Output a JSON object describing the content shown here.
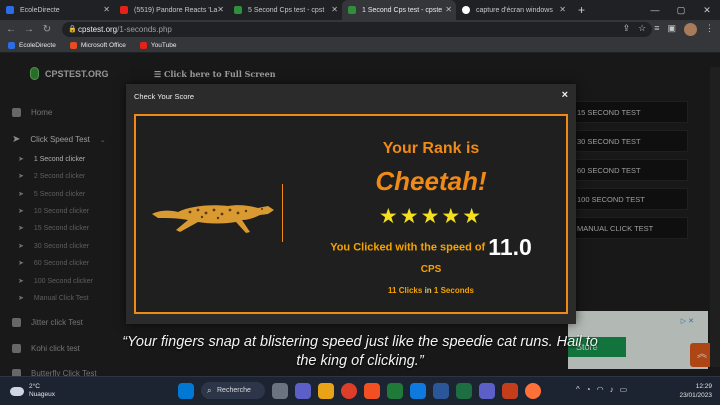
{
  "tabs": [
    {
      "label": "EcoleDirecte",
      "color": "#2b6de8",
      "active": false
    },
    {
      "label": "(5519) Pandore Reacts 'La",
      "color": "#e62117",
      "active": false
    },
    {
      "label": "5 Second Cps test - cpst",
      "color": "#2f8f3a",
      "active": false
    },
    {
      "label": "1 Second Cps test - cpste",
      "color": "#2f8f3a",
      "active": true
    },
    {
      "label": "capture d'écran windows",
      "color": "#ffffff",
      "active": false
    }
  ],
  "address": {
    "domain": "cpstest.org",
    "path": "/1-seconds.php"
  },
  "bookmarks": [
    {
      "label": "EcoleDirecte",
      "color": "#2b6de8"
    },
    {
      "label": "Microsoft Office",
      "color": "#e94a1f"
    },
    {
      "label": "YouTube",
      "color": "#e62117"
    }
  ],
  "site": {
    "logo": "CPSTEST.ORG",
    "fullscreen": "Click here to Full Screen",
    "nav": {
      "home": "Home",
      "click_speed": "Click Speed Test",
      "jitter": "Jitter click Test",
      "kohi": "Kohi click test",
      "butterfly": "Butterfly Click Test"
    },
    "subnav": [
      "1 Second clicker",
      "2 Second clicker",
      "5 Second clicker",
      "10 Second clicker",
      "15 Second clicker",
      "30 Second clicker",
      "60 Second clicker",
      "100 Second clicker",
      "Manual Click Test"
    ],
    "right_buttons": [
      "15 SECOND TEST",
      "30 SECOND TEST",
      "60 SECOND TEST",
      "100 SECOND TEST",
      "MANUAL CLICK TEST"
    ],
    "ad_button": "Store"
  },
  "modal": {
    "title": "Check Your Score",
    "close": "×",
    "rank_label": "Your Rank is",
    "animal": "Cheetah!",
    "stars": "★★★★★",
    "speed_text": "You Clicked with the speed of",
    "speed_value": "11.0",
    "cps": "CPS",
    "clicks": "11",
    "clicks_word": "Clicks",
    "in_word": "in",
    "seconds": "1",
    "seconds_word": "Seconds"
  },
  "quote": "“Your fingers snap at blistering speed just like the speedie cat runs. Hail to the king of clicking.”",
  "taskbar": {
    "temp": "2°C",
    "weather": "Nuageux",
    "search": "Recherche",
    "time": "12:29",
    "date": "23/01/2023",
    "icon_colors": [
      "#0078d4",
      "#ffffff",
      "#5b5fc7",
      "#ffb900",
      "#e8a317",
      "#1f7a3a",
      "#0e7ae0",
      "#c43e1c",
      "#ff7139",
      "#cc3d3d",
      "#5b5fc7",
      "#e8a317"
    ]
  }
}
